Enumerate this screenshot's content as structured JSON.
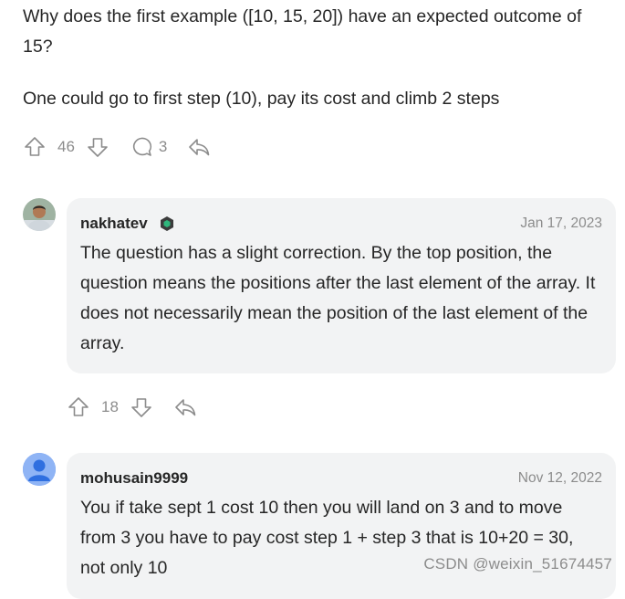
{
  "post": {
    "paragraph1": "Why does the first example ([10, 15, 20]) have an expected outcome of 15?",
    "paragraph2": "One could go to first step (10), pay its cost and climb 2 steps",
    "upvotes": "46",
    "replies": "3"
  },
  "comments": [
    {
      "username": "nakhatev",
      "date": "Jan 17, 2023",
      "text": "The question has a slight correction. By the top position, the question means the positions after the last element of the array. It does not necessarily mean the position of the last element of the array.",
      "upvotes": "18"
    },
    {
      "username": "mohusain9999",
      "date": "Nov 12, 2022",
      "text": "You if take sept 1 cost 10 then you will land on 3 and to move from 3 you have to pay cost step 1 + step 3 that is 10+20 = 30, not only 10"
    }
  ],
  "watermark": "CSDN @weixin_51674457",
  "colors": {
    "icon": "#8c8c8c",
    "bubble": "#f2f3f4",
    "avatar_default": "#5b8def"
  }
}
